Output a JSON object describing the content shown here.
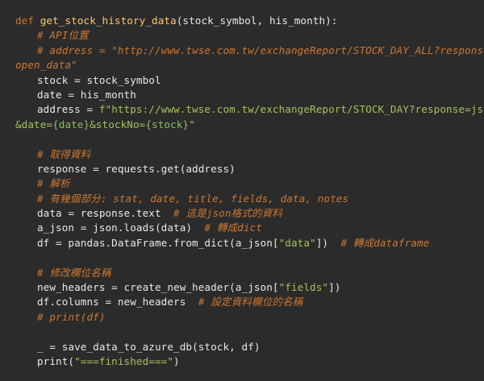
{
  "code": {
    "def_kw": "def",
    "func_name": "get_stock_history_data",
    "params": "(stock_symbol, his_month):",
    "comment_api": "# API位置",
    "comment_address_a": "# address = \"http://www.twse.com.tw/exchangeReport/STOCK_DAY_ALL?response=",
    "comment_address_b": "open_data\"",
    "stock_assign": "stock = stock_symbol",
    "date_assign": "date = his_month",
    "address_prefix": "address = ",
    "address_fstring_a": "f\"https://www.twse.com.tw/exchangeReport/STOCK_DAY?response=json",
    "address_fstring_b1": "&date=",
    "address_fstring_b2": "{date}",
    "address_fstring_b3": "&stockNo=",
    "address_fstring_b4": "{stock}",
    "address_fstring_b5": "\"",
    "comment_fetch": "# 取得資料",
    "response_assign": "response = requests.get(address)",
    "comment_parse": "# 解析",
    "comment_parts": "# 有幾個部分: stat, date, title, fields, data, notes",
    "data_assign": "data = response.text  ",
    "comment_json_text": "# 這是json格式的資料",
    "a_json_assign": "a_json = json.loads(data)  ",
    "comment_to_dict": "# 轉成dict",
    "df_assign_a": "df = pandas.DataFrame.from_dict(a_json[",
    "df_assign_str": "\"data\"",
    "df_assign_b": "])  ",
    "comment_to_df": "# 轉成dataframe",
    "comment_rename": "# 修改欄位名稱",
    "headers_assign_a": "new_headers = create_new_header(a_json[",
    "headers_assign_str": "\"fields\"",
    "headers_assign_b": "])",
    "columns_assign": "df.columns = new_headers  ",
    "comment_set_cols": "# 設定資料欄位的名稱",
    "comment_print_df": "# print(df)",
    "save_call": "_ = save_data_to_azure_db(stock, df)",
    "print_a": "print(",
    "print_str": "\"===finished===\"",
    "print_b": ")"
  },
  "colors": {
    "background": "#2b2b2b",
    "keyword": "#cc7832",
    "function_name": "#ffc66d",
    "comment": "#cc7832",
    "string": "#a5c25c",
    "plain": "#e8e8e8"
  }
}
